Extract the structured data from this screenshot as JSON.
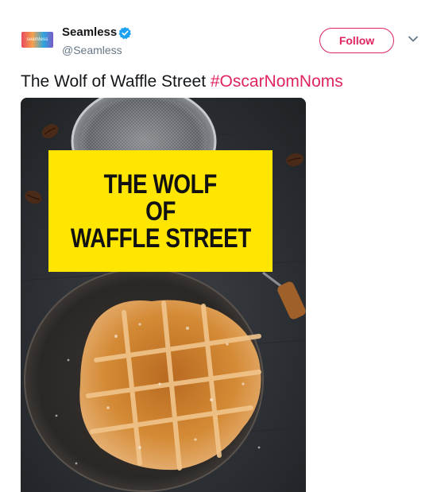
{
  "tweet": {
    "author_name": "Seamless",
    "author_handle": "@Seamless",
    "avatar_text": "seamless",
    "follow_label": "Follow",
    "text": "The Wolf of Waffle Street ",
    "hashtag": "#OscarNomNoms",
    "media": {
      "poster_lines": [
        "THE WOLF",
        "OF",
        "WAFFLE STREET"
      ],
      "subject": "waffle on plate with coffee beans and sieve"
    }
  },
  "colors": {
    "accent": "#e0245e",
    "verified": "#1da1f2",
    "poster_bg": "#ffe600",
    "text": "#14171a",
    "muted": "#657786"
  }
}
